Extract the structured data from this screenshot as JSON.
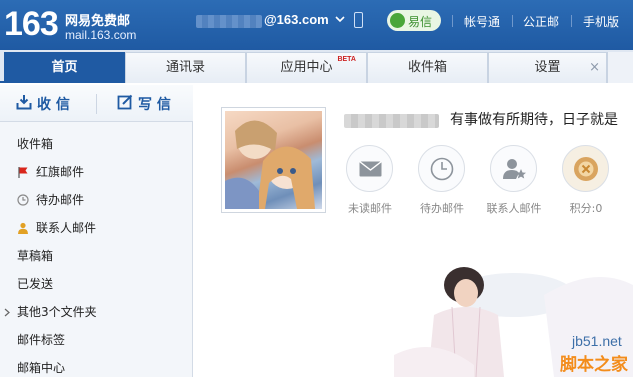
{
  "header": {
    "logo_number": "163",
    "logo_name": "网易免费邮",
    "logo_domain": "mail.163.com",
    "account_suffix": "@163.com",
    "yixin_label": "易信",
    "links": [
      "帐号通",
      "公正邮",
      "手机版"
    ]
  },
  "tabs": [
    {
      "label": "首页",
      "active": true
    },
    {
      "label": "通讯录",
      "active": false
    },
    {
      "label": "应用中心",
      "badge": "BETA",
      "active": false
    },
    {
      "label": "收件箱",
      "active": false
    },
    {
      "label": "设置",
      "close": "×",
      "active": false
    }
  ],
  "sidebar": {
    "receive_label": "收 信",
    "compose_label": "写 信",
    "folders": [
      {
        "label": "收件箱",
        "icon": ""
      },
      {
        "label": "红旗邮件",
        "icon": "red-flag-icon"
      },
      {
        "label": "待办邮件",
        "icon": "clock-icon"
      },
      {
        "label": "联系人邮件",
        "icon": "contact-icon"
      },
      {
        "label": "草稿箱",
        "icon": ""
      },
      {
        "label": "已发送",
        "icon": ""
      },
      {
        "label": "其他3个文件夹",
        "icon": "chevron-right-icon"
      },
      {
        "label": "邮件标签",
        "icon": ""
      },
      {
        "label": "邮箱中心",
        "icon": ""
      }
    ]
  },
  "profile": {
    "motto": "有事做有所期待，日子就是",
    "stats": [
      {
        "label": "未读邮件",
        "icon": "envelope-icon"
      },
      {
        "label": "待办邮件",
        "icon": "clock-icon"
      },
      {
        "label": "联系人邮件",
        "icon": "contact-star-icon"
      },
      {
        "label": "积分:0",
        "icon": "points-icon"
      }
    ]
  },
  "watermark": {
    "site": "jb51.net",
    "name": "脚本之家"
  },
  "colors": {
    "header_blue": "#1f5aa3",
    "accent_orange": "#f38d1c",
    "yixin_green": "#49a63a",
    "flag_red": "#d9261c"
  }
}
